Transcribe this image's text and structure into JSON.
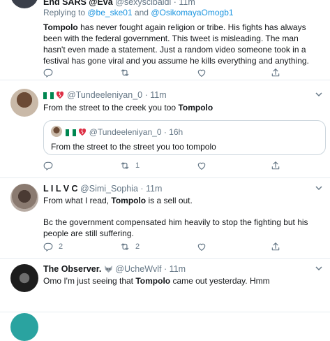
{
  "tweet1": {
    "name": "End SARS @Eva",
    "handle": "@sexyscibaldi · 11m",
    "replying_prefix": "Replying to ",
    "replying_user1": "@be_ske01",
    "replying_and": " and ",
    "replying_user2": "@OsikomayaOmogb1",
    "body_bold": "Tompolo",
    "body_rest": " has never fought again religion or tribe. His fights has always been with the federal government. This tweet is misleading. The man hasn't even made a statement. Just a random video someone took in a festival has gone viral and you assume he kills everything and anything."
  },
  "tweet2": {
    "handle": "@Tundeeleniyan_0 · 11m",
    "body_pre": "From the street to the creek you too ",
    "body_bold": "Tompolo",
    "retweets": "1",
    "quote": {
      "handle": "@Tundeeleniyan_0 · 16h",
      "body": "From the street to the street you too tompolo"
    }
  },
  "tweet3": {
    "name": "L I L V C",
    "handle": "@Simi_Sophia · 11m",
    "body_pre": "From what I read, ",
    "body_bold": "Tompolo",
    "body_post": " is a sell out.",
    "body_para2": "Bc the government compensated him heavily to stop the fighting but his people are still suffering.",
    "replies": "2",
    "retweets": "2"
  },
  "tweet4": {
    "name": "The Observer.",
    "handle": "@UcheWvlf · 11m",
    "body_pre": "Omo I'm just seeing that ",
    "body_bold": "Tompolo",
    "body_post": " came out yesterday. Hmm"
  },
  "colors": {
    "accent": "#1b95e0",
    "muted": "#657786",
    "border": "#e6ecf0",
    "like": "#e0245e"
  },
  "icons": [
    "reply-icon",
    "retweet-icon",
    "like-icon",
    "share-icon",
    "chevron-down-icon",
    "nigeria-flag-icon",
    "broken-heart-icon",
    "wolf-emoji-icon"
  ]
}
